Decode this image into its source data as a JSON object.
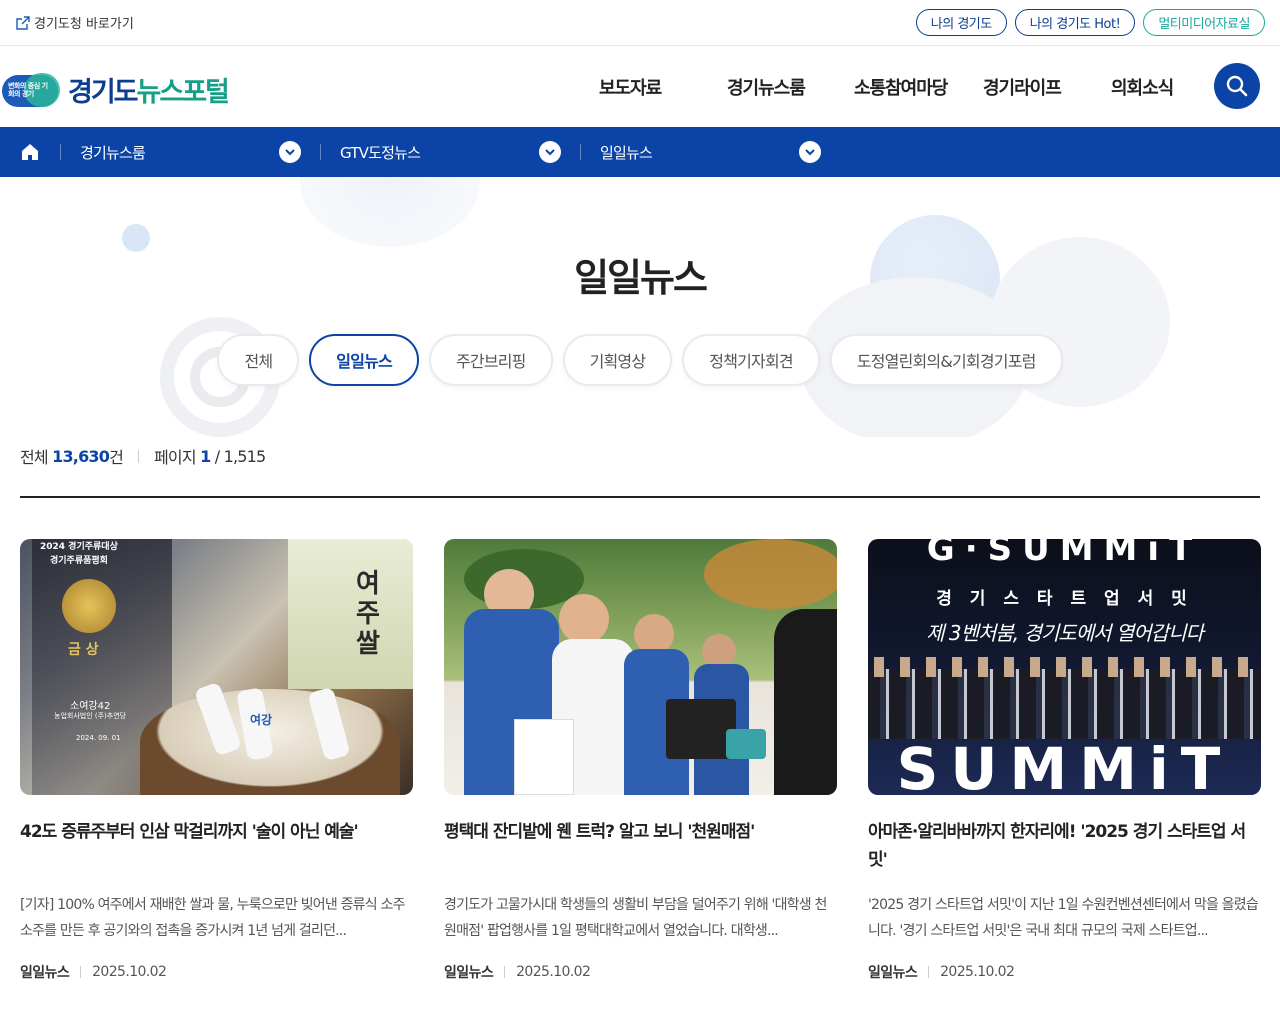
{
  "util": {
    "gov_link": "경기도청 바로가기",
    "pills": [
      "나의 경기도",
      "나의 경기도 Hot!",
      "멀티미디어자료실"
    ]
  },
  "header": {
    "logo_mark_text": "변화의 중심 기회의 경기",
    "logo_name_a": "경기도",
    "logo_name_b": "뉴스포털",
    "gnb": [
      "보도자료",
      "경기뉴스룸",
      "소통참여마당",
      "경기라이프",
      "의회소식"
    ]
  },
  "bluenav": {
    "items": [
      "경기뉴스룸",
      "GTV도정뉴스",
      "일일뉴스"
    ]
  },
  "hero": {
    "title": "일일뉴스",
    "tabs": [
      "전체",
      "일일뉴스",
      "주간브리핑",
      "기획영상",
      "정책기자회견",
      "도정열린회의&기회경기포럼"
    ],
    "active_tab": 1
  },
  "summary": {
    "total_label": "전체",
    "total_value": "13,630",
    "total_unit": "건",
    "page_label": "페이지",
    "page_current": "1",
    "page_total": "/ 1,515"
  },
  "cards": [
    {
      "title": "42도 증류주부터 인삼 막걸리까지 '술이 아닌 예술'",
      "desc": "[기자] 100% 여주에서 재배한 쌀과 물, 누룩으로만 빚어낸 증류식 소주 소주를 만든 후 공기와의 접촉을 증가시켜 1년 넘게 걸리던...",
      "category": "일일뉴스",
      "date": "2025.10.02",
      "thumb_texts": [
        "2024 경기주류대상",
        "경기주류품평회",
        "금 상",
        "소여강42",
        "농업회사법인 (주)추연당",
        "2024. 09. 01",
        "여주쌀",
        "여강"
      ]
    },
    {
      "title": "평택대 잔디밭에 웬 트럭? 알고 보니 '천원매점'",
      "desc": "경기도가 고물가시대 학생들의 생활비 부담을 덜어주기 위해 '대학생 천원매점' 팝업행사를 1일 평택대학교에서 열었습니다. 대학생...",
      "category": "일일뉴스",
      "date": "2025.10.02",
      "thumb_texts": []
    },
    {
      "title": "아마존·알리바바까지 한자리에! '2025 경기 스타트업 서밋'",
      "desc": "'2025 경기 스타트업 서밋'이 지난 1일 수원컨벤션센터에서 막을 올렸습니다. '경기 스타트업 서밋'은 국내 최대 규모의 국제 스타트업...",
      "category": "일일뉴스",
      "date": "2025.10.02",
      "thumb_texts": [
        "G·SUMMiT",
        "경 기 스 타 트 업 서 밋",
        "제 3벤처붐, 경기도에서 열어갑니다",
        "SUMMiT"
      ]
    }
  ],
  "colors": {
    "primary": "#0b44a6",
    "teal": "#1aa89c"
  }
}
